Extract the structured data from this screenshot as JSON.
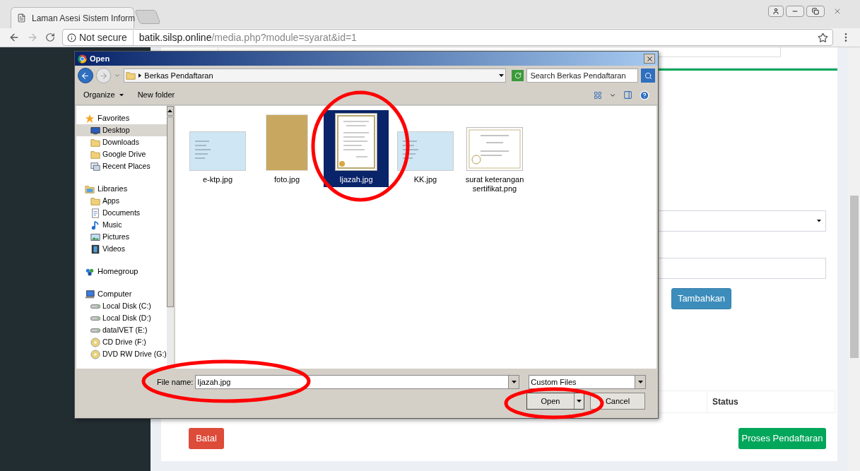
{
  "browser": {
    "tab_title": "Laman Asesi Sistem Inform",
    "not_secure": "Not secure",
    "url_domain": "batik.silsp.online",
    "url_path": "/media.php?module=syarat&id=1"
  },
  "page": {
    "add_button": "Tambahkan",
    "table_header": "Status",
    "cancel_button": "Batal",
    "submit_button": "Proses Pendaftaran"
  },
  "dialog": {
    "title": "Open",
    "location": "Berkas Pendaftaran",
    "search_placeholder": "Search Berkas Pendaftaran",
    "organize": "Organize",
    "new_folder": "New folder",
    "nav": [
      {
        "label": "Favorites",
        "items": [
          {
            "label": "Desktop",
            "selected": true
          },
          {
            "label": "Downloads",
            "selected": false
          },
          {
            "label": "Google Drive",
            "selected": false
          },
          {
            "label": "Recent Places",
            "selected": false
          }
        ]
      },
      {
        "label": "Libraries",
        "items": [
          {
            "label": "Apps",
            "selected": false
          },
          {
            "label": "Documents",
            "selected": false
          },
          {
            "label": "Music",
            "selected": false
          },
          {
            "label": "Pictures",
            "selected": false
          },
          {
            "label": "Videos",
            "selected": false
          }
        ]
      },
      {
        "label": "Homegroup"
      },
      {
        "label": "Computer",
        "items": [
          {
            "label": "Local Disk (C:)",
            "selected": false
          },
          {
            "label": "Local Disk (D:)",
            "selected": false
          },
          {
            "label": "dataIVET (E:)",
            "selected": false
          },
          {
            "label": "CD Drive (F:)",
            "selected": false
          },
          {
            "label": "DVD RW Drive (G:)",
            "selected": false
          }
        ]
      }
    ],
    "files": [
      {
        "name": "e-ktp.jpg",
        "kind": "card",
        "selected": false
      },
      {
        "name": "foto.jpg",
        "kind": "photo",
        "selected": false
      },
      {
        "name": "Ijazah.jpg",
        "kind": "document",
        "selected": true
      },
      {
        "name": "KK.jpg",
        "kind": "card",
        "selected": false
      },
      {
        "name": "surat keterangan sertifikat.png",
        "kind": "certificate",
        "selected": false
      }
    ],
    "file_name_label": "File name:",
    "file_name": "Ijazah.jpg",
    "file_type": "Custom Files",
    "open_button": "Open",
    "cancel_button": "Cancel"
  }
}
